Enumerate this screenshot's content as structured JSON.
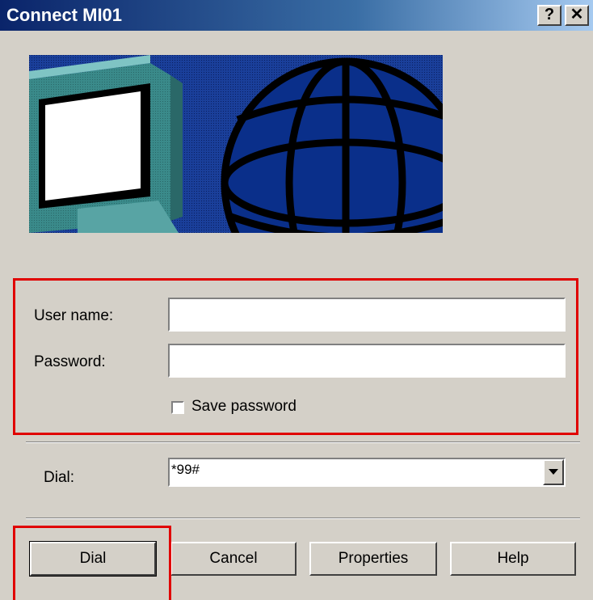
{
  "window": {
    "title": "Connect MI01",
    "help_glyph": "?",
    "close_glyph": "✕"
  },
  "credentials": {
    "username_label": "User name:",
    "username_value": "",
    "password_label": "Password:",
    "password_value": "",
    "save_password_label": "Save password",
    "save_password_checked": false
  },
  "dial": {
    "label": "Dial:",
    "value": "*99#"
  },
  "buttons": {
    "dial": "Dial",
    "cancel": "Cancel",
    "properties": "Properties",
    "help": "Help"
  },
  "colors": {
    "highlight": "#e00000",
    "titlebar": "#0a246a",
    "face": "#d4d0c8"
  }
}
